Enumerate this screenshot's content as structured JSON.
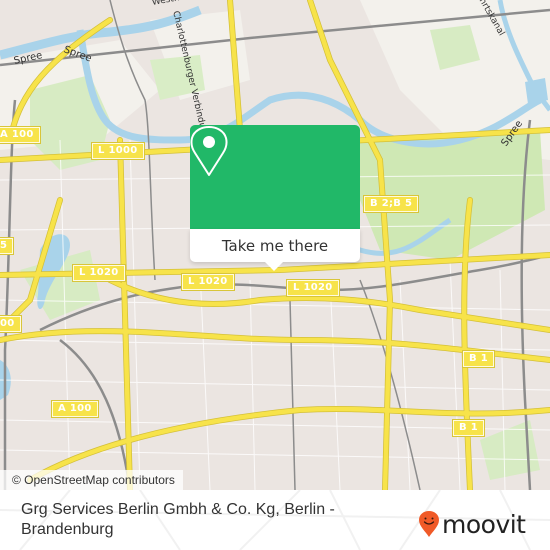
{
  "map": {
    "attribution": "© OpenStreetMap contributors",
    "road_labels": [
      {
        "id": "a100-top",
        "text": "A 100"
      },
      {
        "id": "l1000",
        "text": "L 1000"
      },
      {
        "id": "a100-left",
        "text": "5"
      },
      {
        "id": "l1020-left",
        "text": "L 1020"
      },
      {
        "id": "l1020-mid",
        "text": "L 1020"
      },
      {
        "id": "l1020-right",
        "text": "L 1020"
      },
      {
        "id": "a100-edge",
        "text": "00"
      },
      {
        "id": "b2b5",
        "text": "B 2;B 5"
      },
      {
        "id": "b1-top",
        "text": "B 1"
      },
      {
        "id": "b1-bottom",
        "text": "B 1"
      },
      {
        "id": "a100-bottom",
        "text": "A 100"
      }
    ],
    "water_labels": [
      {
        "id": "spree-1",
        "text": "Spree"
      },
      {
        "id": "spree-2",
        "text": "Spree"
      },
      {
        "id": "spree-3",
        "text": "Spree"
      }
    ],
    "street_labels": [
      {
        "id": "westhafen",
        "text": "Westhafen"
      },
      {
        "id": "charlottenburger",
        "text": "Charlottenburger Verbindungskanal"
      },
      {
        "id": "kanal",
        "text": "Schiffahrtskanal"
      }
    ],
    "colors": {
      "land": "#f2efe9",
      "urban": "#e8e0dc",
      "park": "#cfe8b4",
      "water": "#a9d3ea",
      "road": "#f7e34a",
      "rail": "#888888"
    }
  },
  "popup": {
    "button_label": "Take me there",
    "icon": "map-pin-icon",
    "color": "#21b868"
  },
  "footer": {
    "place_title": "Grg Services Berlin Gmbh & Co. Kg, Berlin - Brandenburg",
    "brand": "moovit",
    "brand_color": "#f05a28"
  }
}
